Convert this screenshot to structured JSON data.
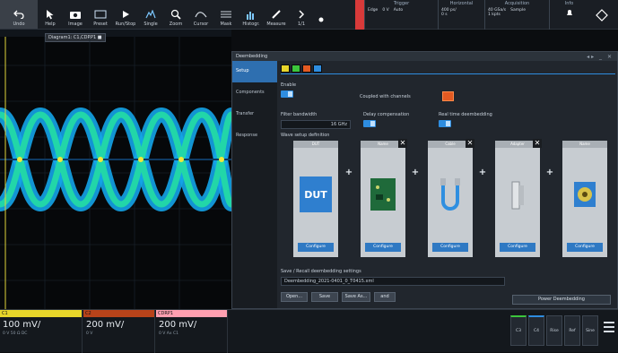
{
  "toolbar": {
    "items": [
      {
        "label": "Undo",
        "icon": "undo-icon"
      },
      {
        "label": "Help",
        "icon": "pointer-icon"
      },
      {
        "label": "Image",
        "icon": "camera-icon"
      },
      {
        "label": "Preset",
        "icon": "preset-icon"
      },
      {
        "label": "Run/Stop",
        "icon": "play-icon"
      },
      {
        "label": "Single",
        "icon": "single-icon"
      },
      {
        "label": "Zoom",
        "icon": "zoom-icon"
      },
      {
        "label": "Cursor",
        "icon": "cursor-icon"
      },
      {
        "label": "Mask",
        "icon": "mask-icon"
      },
      {
        "label": "Histogr.",
        "icon": "histogram-icon"
      },
      {
        "label": "Measure",
        "icon": "measure-icon"
      },
      {
        "label": "1/1",
        "icon": "next-icon"
      },
      {
        "label": "",
        "icon": "menu-dot-icon"
      }
    ]
  },
  "trigger": {
    "trigger_header": "Trigger",
    "edge": "Edge",
    "level": "0 V",
    "mode": "Auto",
    "horizontal_header": "Horizontal",
    "hor_val1": "400 ps/",
    "hor_val2": "0 s",
    "acq_header": "Acquisition",
    "acq_val1": "40 GSa/s",
    "acq_val2": "Sample",
    "acq_val3": "1 kpts",
    "info_header": "Info"
  },
  "waveform": {
    "tab_label": "Diagram1: C1,CDRP1 ■"
  },
  "dialog": {
    "title": "Deembedding",
    "nav": [
      "Setup",
      "Components",
      "Transfer",
      "Response"
    ],
    "enable_label": "Enable",
    "coupled_label": "Coupled with channels",
    "filter_bw_label": "Filter bandwidth",
    "filter_bw_value": "16 GHz",
    "delay_comp_label": "Delay compensation",
    "realtime_label": "Real time deembedding",
    "wave_setup_label": "Wave setup definition",
    "blocks": [
      {
        "header": "DUT",
        "type": "dut",
        "config": "Configure",
        "closable": false
      },
      {
        "header": "Name",
        "type": "pcb",
        "config": "Configure",
        "closable": true
      },
      {
        "header": "Cable",
        "type": "cable",
        "config": "Configure",
        "closable": true
      },
      {
        "header": "Adapter",
        "type": "adapter",
        "config": "Configure",
        "closable": true
      },
      {
        "header": "Name",
        "type": "probe",
        "config": "Configure",
        "closable": false
      }
    ],
    "dut_text": "DUT",
    "save_recall_label": "Save / Recall deembedding settings",
    "file_path": "Deembedding_2021-0401_0_T0415.xml",
    "buttons": {
      "open": "Open...",
      "save": "Save",
      "save_as": "Save As...",
      "more": "and",
      "power": "Power Deembedding"
    }
  },
  "bottom": {
    "channels": [
      {
        "name": "C1",
        "color": "#e8d62a",
        "value": "100 mV/",
        "sub": "0 V  50 Ω  DC"
      },
      {
        "name": "C2",
        "color": "#e05a2a",
        "value": "200 mV/",
        "sub": "0 V"
      },
      {
        "name": "CDRP1",
        "color": "#ff9fb0",
        "value": "200 mV/",
        "sub": "0 V  Ax C1"
      }
    ],
    "right_buttons": [
      "C3",
      "C4",
      "Rise",
      "Ref",
      "Sine"
    ]
  },
  "colors": {
    "accent": "#2e8de0",
    "toggle": "#2e8de0",
    "orange": "#e35a22"
  }
}
